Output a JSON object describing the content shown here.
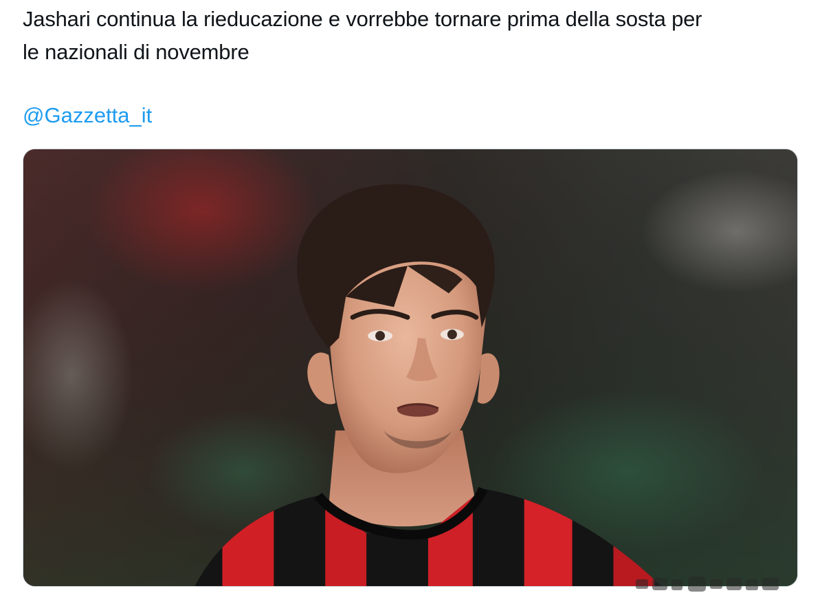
{
  "tweet": {
    "text_lines": [
      "Jashari continua la rieducazione e vorrebbe tornare prima della sosta per",
      "le nazionali di novembre"
    ],
    "mention": "@Gazzetta_it"
  },
  "colors": {
    "text": "#0f1419",
    "link": "#1d9bf0",
    "media_border": "#cfd9de",
    "kit_red": "#d11f26",
    "kit_black": "#111111"
  },
  "media": {
    "kind": "photo",
    "subject": "footballer-portrait"
  }
}
